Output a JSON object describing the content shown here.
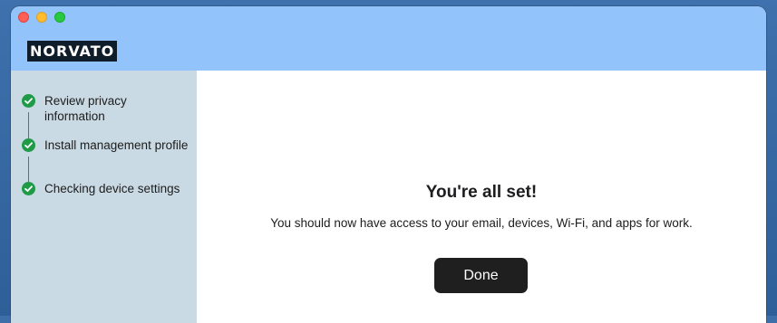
{
  "window": {
    "brand": "NORVATO",
    "controls": [
      "close",
      "minimize",
      "zoom"
    ]
  },
  "sidebar": {
    "steps": [
      {
        "label": "Review privacy information",
        "status": "complete",
        "icon": "check-circle-icon"
      },
      {
        "label": "Install management profile",
        "status": "complete",
        "icon": "check-circle-icon"
      },
      {
        "label": "Checking device settings",
        "status": "complete",
        "icon": "check-circle-icon"
      }
    ]
  },
  "main": {
    "heading": "You're all set!",
    "message": "You should now have access to your email, devices, Wi-Fi, and apps for work.",
    "done_label": "Done"
  },
  "colors": {
    "titlebar": "#93c3fb",
    "sidebar": "#c9dae4",
    "check": "#1f9a46",
    "button": "#1f1f1f",
    "brand_bg": "#0f1c2a"
  }
}
